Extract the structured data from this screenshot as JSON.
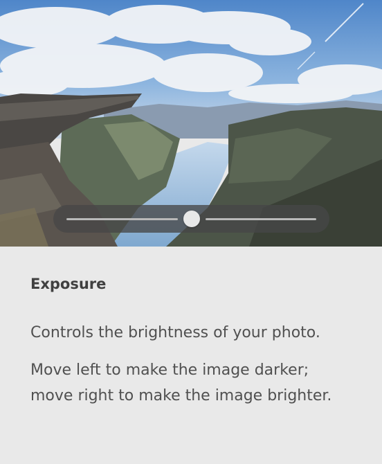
{
  "exposure": {
    "title": "Exposure",
    "description_1": "Controls the brightness of your photo.",
    "description_2": "Move left to make the image darker; move right to make the image brighter."
  },
  "slider": {
    "value_fraction": 0.5
  },
  "colors": {
    "panel_background": "#e9e9e9",
    "title_text": "#404040",
    "body_text": "#505050",
    "slider_background": "#464646",
    "slider_thumb": "#e8e8e8"
  },
  "icons": {
    "preview_image": "mountain-fjord-photo"
  }
}
